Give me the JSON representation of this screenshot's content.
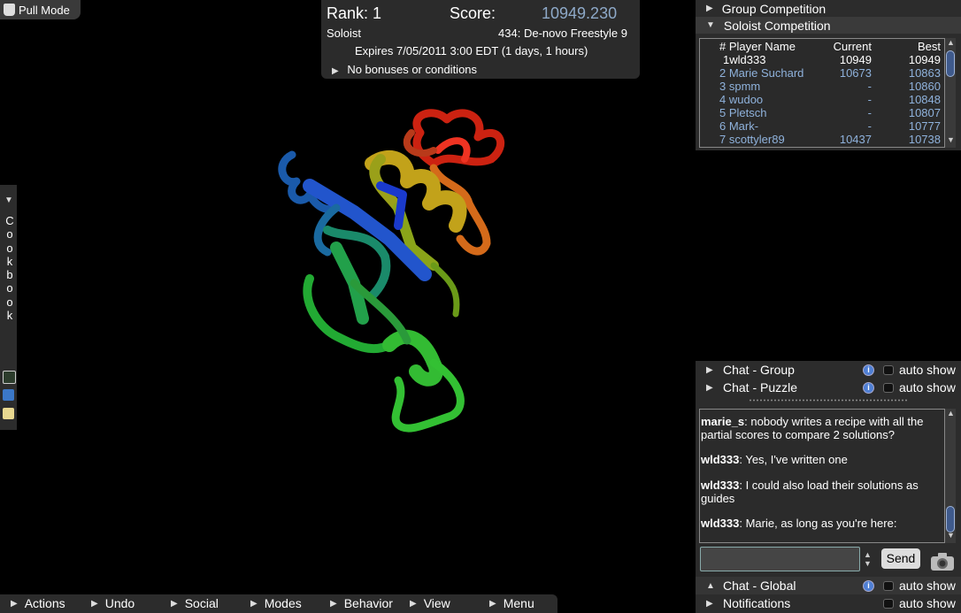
{
  "pull_mode": {
    "label": "Pull Mode"
  },
  "score_panel": {
    "rank": "Rank: 1",
    "score_label": "Score:",
    "score_value": "10949.230",
    "mode": "Soloist",
    "puzzle": "434: De-novo Freestyle 9",
    "expires": "Expires 7/05/2011 3:00 EDT (1 days, 1 hours)",
    "bonus": "No bonuses or conditions"
  },
  "competition": {
    "group_label": "Group Competition",
    "soloist_label": "Soloist Competition",
    "columns": {
      "player": "# Player Name",
      "current": "Current",
      "best": "Best"
    },
    "rows": [
      {
        "player": "1wld333",
        "current": "10949",
        "best": "10949"
      },
      {
        "player": "2 Marie Suchard",
        "current": "10673",
        "best": "10863"
      },
      {
        "player": "3 spmm",
        "current": "-",
        "best": "10860"
      },
      {
        "player": "4 wudoo",
        "current": "-",
        "best": "10848"
      },
      {
        "player": "5 Pletsch",
        "current": "-",
        "best": "10807"
      },
      {
        "player": "6 Mark-",
        "current": "-",
        "best": "10777"
      },
      {
        "player": "7 scottyler89",
        "current": "10437",
        "best": "10738"
      }
    ]
  },
  "cookbook": {
    "label": "Cookbook"
  },
  "chat": {
    "group_label": "Chat - Group",
    "puzzle_label": "Chat - Puzzle",
    "global_label": "Chat - Global",
    "notifications_label": "Notifications",
    "auto_show": "auto show",
    "info": "i",
    "send": "Send",
    "messages": [
      {
        "user": "marie_s",
        "text": ": nobody writes a recipe with all the partial scores to compare 2 solutions?"
      },
      {
        "user": "wld333",
        "text": ": Yes, I've written one"
      },
      {
        "user": "wld333",
        "text": ": I could also load their solutions as guides"
      },
      {
        "user": "wld333",
        "text": ": Marie, as long as you're here:"
      }
    ]
  },
  "bottom_menu": {
    "items": [
      "Actions",
      "Undo",
      "Social",
      "Modes",
      "Behavior",
      "View",
      "Menu"
    ]
  },
  "colors": {
    "score_blue": "#8ea9c8",
    "player_blue": "#8fb2dc",
    "panel": "#2c2c2c"
  }
}
